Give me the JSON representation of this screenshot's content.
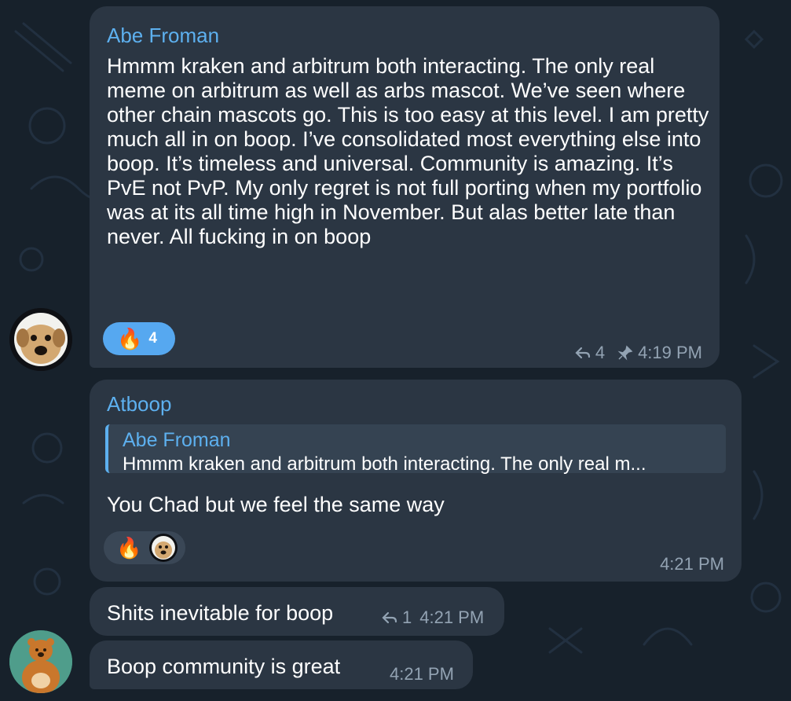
{
  "messages": [
    {
      "sender": "Abe Froman",
      "text": "Hmmm kraken and arbitrum both interacting. The only real meme on arbitrum as well as arbs mascot. We’ve seen where other chain mascots go. This is too easy at this level. I am pretty much all in on boop. I’ve consolidated most everything else into boop. It’s timeless and universal. Community is amazing. It’s PvE not PvP. My only regret is not full porting when my portfolio was at its all time high in November. But alas better late than never. All fucking in on boop",
      "reaction": {
        "emoji": "🔥",
        "count": "4"
      },
      "replies": "4",
      "time": "4:19 PM",
      "icons": [
        "reply-arrow-icon",
        "pin-icon"
      ]
    },
    {
      "sender": "Atboop",
      "quote": {
        "sender": "Abe Froman",
        "text": "Hmmm kraken and arbitrum both interacting. The only real m..."
      },
      "text": "You Chad but we feel the same way",
      "reactions": [
        "🔥",
        "dog-avatar"
      ],
      "time": "4:21 PM"
    },
    {
      "text": "Shits inevitable for boop",
      "replies": "1",
      "time": "4:21 PM"
    },
    {
      "text": "Boop community is great",
      "time": "4:21 PM"
    }
  ],
  "colors": {
    "background": "#17212b",
    "bubble": "#2b3643",
    "accent": "#5db0ef",
    "reaction_active": "#56a8f0",
    "meta": "#93a3b3"
  }
}
